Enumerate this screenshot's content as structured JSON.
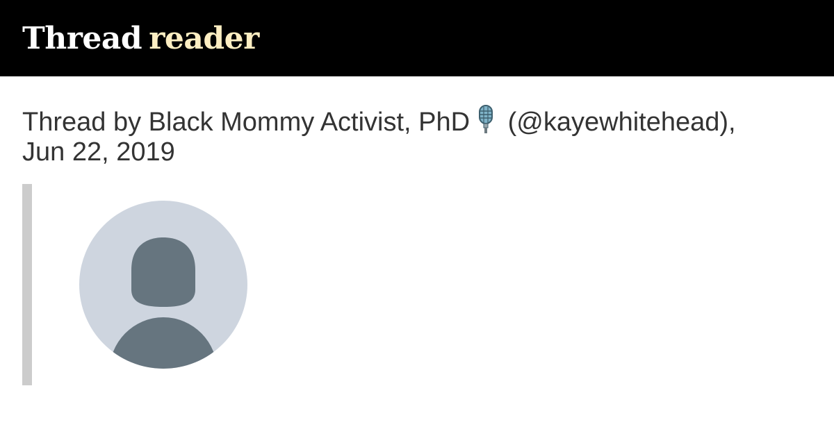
{
  "header": {
    "logo_word1": "Thread",
    "logo_word2": "reader"
  },
  "thread": {
    "title_line": "Thread by Black Mommy Activist, PhD",
    "handle": "(@kayewhitehead),",
    "date": "Jun 22, 2019",
    "title_emoji_icon": "microphone-icon"
  },
  "avatar": {
    "icon": "default-profile-avatar-icon"
  },
  "colors": {
    "header_bg": "#000000",
    "logo_primary": "#ffffff",
    "logo_accent": "#fdeec2",
    "title_text": "#333333",
    "quote_bar": "#cccccc",
    "avatar_bg": "#ced5df",
    "avatar_figure": "#66757f"
  }
}
